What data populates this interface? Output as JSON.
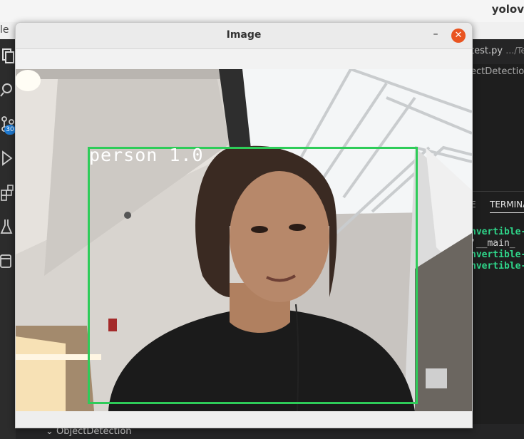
{
  "background_app": {
    "title_fragment": "yolov",
    "menu_fragment": "le",
    "badge_count": "30",
    "editor_tab": {
      "label": "test.py",
      "path": "…/Te"
    },
    "breadcrumb": "ectDetection",
    "panel_tabs": [
      "E",
      "TERMINA"
    ],
    "terminal_lines": [
      {
        "text": "nvertible-",
        "color": "green"
      },
      {
        "text": "'__main_",
        "color": "white"
      },
      {
        "text": "nvertible-",
        "color": "green"
      },
      {
        "text": "nvertible-",
        "color": "green"
      }
    ],
    "explorer_folder": "ObjectDetection"
  },
  "image_window": {
    "title": "Image",
    "minimize_label": "–",
    "close_label": "✕",
    "detection": {
      "label": "person",
      "confidence": "1.0",
      "box_color": "#2ecc59"
    }
  },
  "colors": {
    "close_button": "#e95420",
    "terminal_green": "#2fd68a",
    "badge": "#1f7ad1"
  }
}
